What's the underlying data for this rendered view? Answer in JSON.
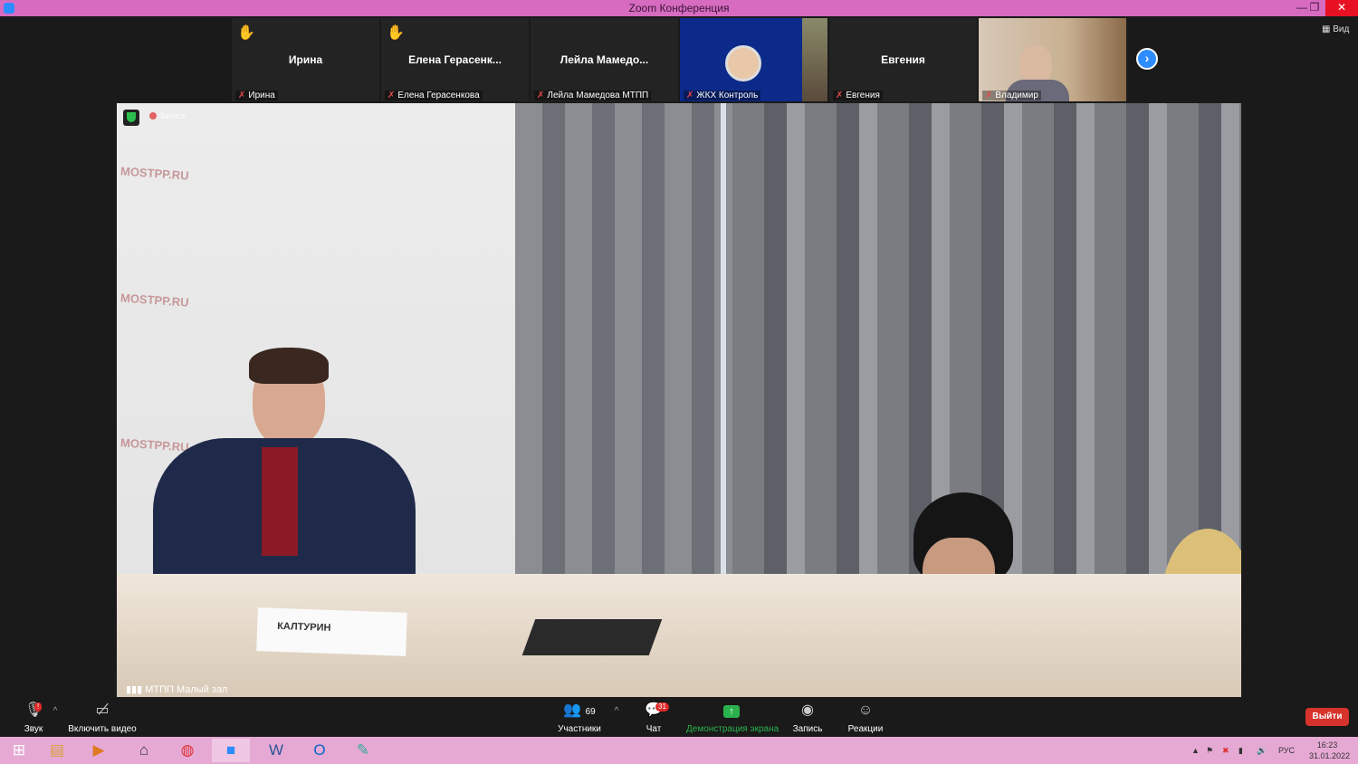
{
  "window": {
    "title": "Zoom Конференция",
    "controls": {
      "minimize": "—",
      "restore": "❐",
      "close": "✕"
    }
  },
  "view_button": "Вид",
  "participants_strip": [
    {
      "display_name": "Ирина",
      "caption": "Ирина",
      "raised_hand": true,
      "has_video": false
    },
    {
      "display_name": "Елена  Герасенк...",
      "caption": "Елена Герасенкова",
      "raised_hand": true,
      "has_video": false
    },
    {
      "display_name": "Лейла  Мамедо...",
      "caption": "Лейла Мамедова МТПП",
      "raised_hand": false,
      "has_video": false
    },
    {
      "display_name": "",
      "caption": "ЖКХ Контроль",
      "raised_hand": false,
      "has_video": true
    },
    {
      "display_name": "Евгения",
      "caption": "Евгения",
      "raised_hand": false,
      "has_video": false
    },
    {
      "display_name": "",
      "caption": "Владимир",
      "raised_hand": false,
      "has_video": true
    }
  ],
  "main_video": {
    "recording_label": "Запись",
    "speaker_label": "МТПП Малый зал",
    "wall_brand": "MOSTPP.RU",
    "nameplate": "КАЛТУРИН"
  },
  "toolbar": {
    "audio": {
      "label": "Звук",
      "icon": "microphone-icon",
      "alert": "!"
    },
    "video": {
      "label": "Включить видео",
      "icon": "video-off-icon"
    },
    "participants": {
      "label": "Участники",
      "count": "69",
      "icon": "participants-icon"
    },
    "chat": {
      "label": "Чат",
      "count": "31",
      "icon": "chat-icon"
    },
    "share": {
      "label": "Демонстрация экрана",
      "icon": "share-screen-icon",
      "color": "#2bb24c"
    },
    "record": {
      "label": "Запись",
      "icon": "record-icon"
    },
    "reactions": {
      "label": "Реакции",
      "icon": "reactions-icon"
    },
    "exit": {
      "label": "Выйти",
      "color": "#d6332c"
    }
  },
  "taskbar": {
    "lang": "РУС",
    "time": "16:23",
    "date": "31.01.2022"
  },
  "colors": {
    "titlebar": "#d66bc0",
    "taskbar": "#e6a9d4",
    "zoom_blue": "#2d8cff"
  }
}
